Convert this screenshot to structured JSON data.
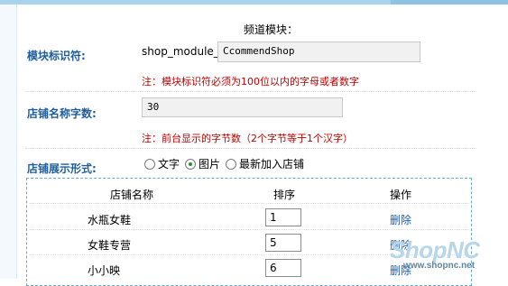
{
  "page": {
    "title": "频道模块："
  },
  "fields": {
    "module_id": {
      "label": "模块标识符:",
      "prefix": "shop_module_",
      "value": "CcommendShop",
      "note": "注：模块标识符必须为100位以内的字母或者数字"
    },
    "name_length": {
      "label": "店铺名称字数:",
      "value": "30",
      "note": "注：前台显示的字节数（2个字节等于1个汉字）"
    },
    "display_mode": {
      "label": "店铺展示形式:",
      "options": [
        "文字",
        "图片",
        "最新加入店铺"
      ],
      "selected": "图片"
    }
  },
  "table": {
    "headers": [
      "店铺名称",
      "排序",
      "操作"
    ],
    "rows": [
      {
        "name": "水瓶女鞋",
        "sort": "1",
        "action": "删除"
      },
      {
        "name": "女鞋专营",
        "sort": "5",
        "action": "删除"
      },
      {
        "name": "小小映",
        "sort": "6",
        "action": "删除"
      }
    ]
  },
  "watermark": {
    "logo": "ShopNC",
    "url": "www.shopnc.net"
  },
  "colors": {
    "label": "#1f5d9a",
    "note": "#c00000",
    "link": "#1a5fb4",
    "top_bar": "#a9d3ec"
  }
}
